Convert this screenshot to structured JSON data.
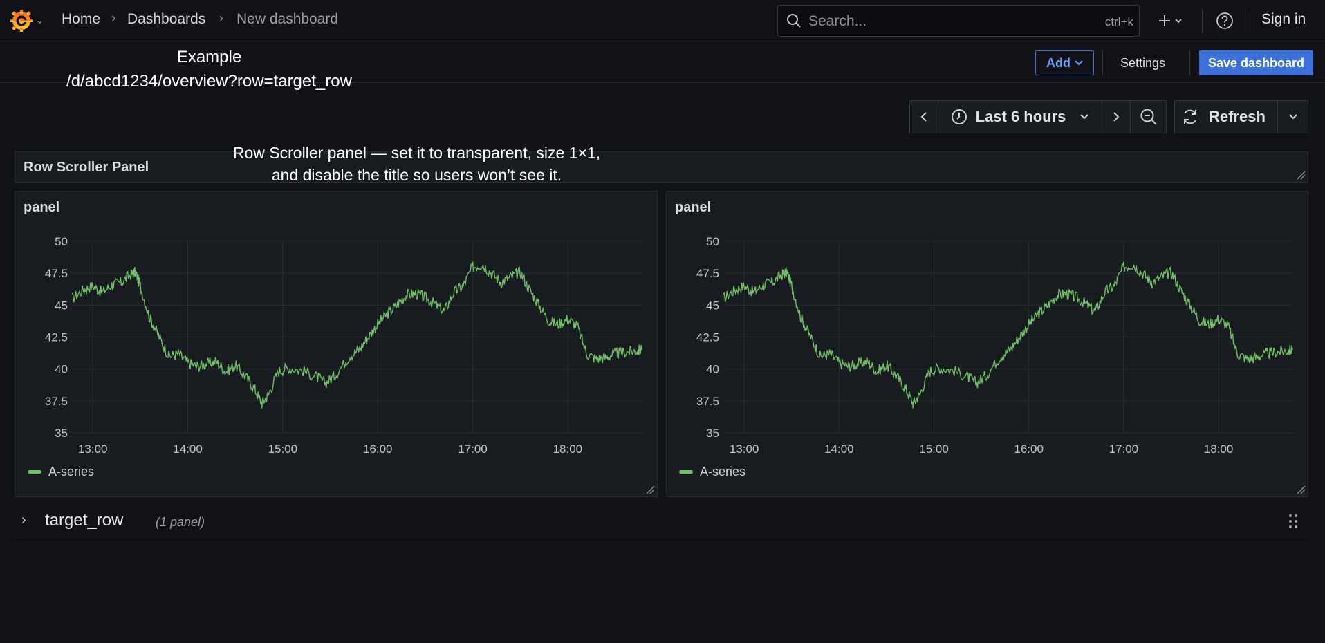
{
  "nav": {
    "breadcrumbs": [
      "Home",
      "Dashboards",
      "New dashboard"
    ],
    "search_placeholder": "Search...",
    "search_shortcut": "ctrl+k",
    "sign_in": "Sign in"
  },
  "toolbar": {
    "example_note_line1": "Example",
    "example_note_line2": "/d/abcd1234/overview?row=target_row",
    "add_label": "Add",
    "settings_label": "Settings",
    "save_label": "Save dashboard"
  },
  "time_controls": {
    "range_label": "Last 6 hours",
    "refresh_label": "Refresh"
  },
  "scroller_panel": {
    "title": "Row Scroller Panel",
    "note_line1": "Row Scroller panel — set it to transparent, size 1×1,",
    "note_line2": "and disable the title so users won’t see it."
  },
  "panels": [
    {
      "title": "panel",
      "legend": "A-series"
    },
    {
      "title": "panel",
      "legend": "A-series"
    }
  ],
  "row": {
    "title": "target_row",
    "count_label": "(1 panel)"
  },
  "colors": {
    "series": "#73bf69",
    "primary": "#3d71d9",
    "background": "#111217",
    "panel": "#181b1f"
  },
  "chart_data": [
    {
      "type": "line",
      "title": "panel",
      "xlabel": "",
      "ylabel": "",
      "x_ticks": [
        "13:00",
        "14:00",
        "15:00",
        "16:00",
        "17:00",
        "18:00"
      ],
      "y_ticks": [
        35,
        37.5,
        40,
        42.5,
        45,
        47.5,
        50
      ],
      "ylim": [
        35,
        50
      ],
      "xlim_hours": [
        12.78,
        18.78
      ],
      "legend": "bottom-left",
      "grid": true,
      "series": [
        {
          "name": "A-series",
          "x": [
            12.78,
            12.9,
            13.0,
            13.1,
            13.2,
            13.3,
            13.4,
            13.45,
            13.5,
            13.6,
            13.7,
            13.8,
            13.9,
            14.0,
            14.1,
            14.2,
            14.3,
            14.4,
            14.5,
            14.6,
            14.7,
            14.78,
            14.85,
            14.95,
            15.05,
            15.2,
            15.35,
            15.45,
            15.55,
            15.7,
            15.8,
            15.9,
            16.0,
            16.1,
            16.2,
            16.3,
            16.4,
            16.5,
            16.6,
            16.7,
            16.8,
            16.9,
            17.0,
            17.1,
            17.2,
            17.3,
            17.4,
            17.5,
            17.6,
            17.7,
            17.8,
            17.9,
            18.0,
            18.1,
            18.2,
            18.3,
            18.4,
            18.5,
            18.6,
            18.7,
            18.78
          ],
          "y": [
            45.5,
            46.2,
            46.5,
            46,
            46.6,
            46.8,
            47.4,
            47.6,
            46.5,
            44,
            42.5,
            41,
            41.2,
            40.5,
            40.2,
            40.4,
            40.6,
            39.8,
            40.3,
            39.5,
            38.5,
            37.3,
            38,
            39.8,
            40.1,
            39.9,
            39.4,
            38.9,
            39.5,
            41,
            41.5,
            42.5,
            43.5,
            44.3,
            45,
            45.8,
            45.9,
            45.6,
            45.1,
            44.5,
            46,
            46.5,
            48,
            48.2,
            47.5,
            46.8,
            47.2,
            47.6,
            46.2,
            45,
            43.8,
            43.5,
            43.9,
            43.4,
            41.2,
            40.8,
            40.9,
            41.2,
            41.3,
            41.4,
            41.5
          ]
        }
      ]
    },
    {
      "type": "line",
      "title": "panel",
      "xlabel": "",
      "ylabel": "",
      "x_ticks": [
        "13:00",
        "14:00",
        "15:00",
        "16:00",
        "17:00",
        "18:00"
      ],
      "y_ticks": [
        35,
        37.5,
        40,
        42.5,
        45,
        47.5,
        50
      ],
      "ylim": [
        35,
        50
      ],
      "xlim_hours": [
        12.78,
        18.78
      ],
      "legend": "bottom-left",
      "grid": true,
      "series": [
        {
          "name": "A-series",
          "x": [
            12.78,
            12.9,
            13.0,
            13.1,
            13.2,
            13.3,
            13.4,
            13.45,
            13.5,
            13.6,
            13.7,
            13.8,
            13.9,
            14.0,
            14.1,
            14.2,
            14.3,
            14.4,
            14.5,
            14.6,
            14.7,
            14.78,
            14.85,
            14.95,
            15.05,
            15.2,
            15.35,
            15.45,
            15.55,
            15.7,
            15.8,
            15.9,
            16.0,
            16.1,
            16.2,
            16.3,
            16.4,
            16.5,
            16.6,
            16.7,
            16.8,
            16.9,
            17.0,
            17.1,
            17.2,
            17.3,
            17.4,
            17.5,
            17.6,
            17.7,
            17.8,
            17.9,
            18.0,
            18.1,
            18.2,
            18.3,
            18.4,
            18.5,
            18.6,
            18.7,
            18.78
          ],
          "y": [
            45.5,
            46.2,
            46.5,
            46,
            46.6,
            46.8,
            47.4,
            47.6,
            46.5,
            44,
            42.5,
            41,
            41.2,
            40.5,
            40.2,
            40.4,
            40.6,
            39.8,
            40.3,
            39.5,
            38.5,
            37.3,
            38,
            39.8,
            40.1,
            39.9,
            39.4,
            38.9,
            39.5,
            41,
            41.5,
            42.5,
            43.5,
            44.3,
            45,
            45.8,
            45.9,
            45.6,
            45.1,
            44.5,
            46,
            46.5,
            48,
            48.2,
            47.5,
            46.8,
            47.2,
            47.6,
            46.2,
            45,
            43.8,
            43.5,
            43.9,
            43.4,
            41.2,
            40.8,
            40.9,
            41.2,
            41.3,
            41.4,
            41.5
          ]
        }
      ]
    }
  ]
}
